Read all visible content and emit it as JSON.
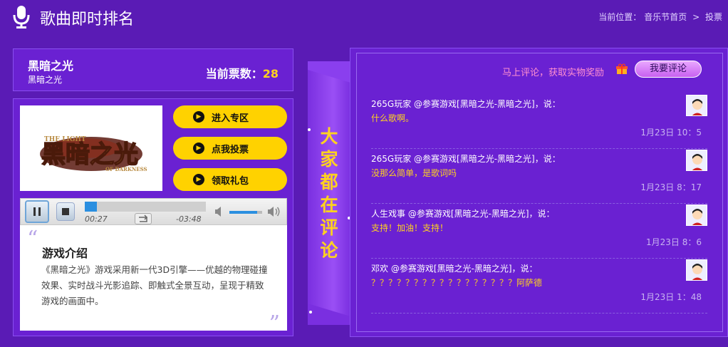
{
  "header": {
    "title": "歌曲即时排名",
    "breadcrumb": {
      "prefix": "当前位置：",
      "home": "音乐节首页",
      "separator": ">",
      "current": "投票"
    }
  },
  "song": {
    "name": "黑暗之光",
    "subtitle": "黑暗之光",
    "votes_label": "当前票数：",
    "votes": "28"
  },
  "game_logo": {
    "main": "黑暗之光",
    "small_top": "THE LIGHT",
    "small_bottom": "OF DARKNESS"
  },
  "actions": [
    {
      "label": "进入专区"
    },
    {
      "label": "点我投票"
    },
    {
      "label": "领取礼包"
    }
  ],
  "player": {
    "current_time": "00:27",
    "remaining_time": "-03:48",
    "progress": 0.1,
    "volume": 0.85
  },
  "intro": {
    "title": "游戏介绍",
    "text": "《黑暗之光》游戏采用新一代3D引擎——优越的物理碰撞效果、实时战斗光影追踪、即触式全景互动，呈现于精致游戏的画面中。"
  },
  "ribbon": {
    "text": "大家都在评论"
  },
  "comments_panel": {
    "promo": "马上评论，获取实物奖励",
    "comment_button": "我要评论",
    "items": [
      {
        "user": "265G玩家 @参赛游戏[黑暗之光-黑暗之光]，说：",
        "text": "什么歌啊。",
        "time": "1月23日 10：5"
      },
      {
        "user": "265G玩家 @参赛游戏[黑暗之光-黑暗之光]，说：",
        "text": "没那么简单，是歌词吗",
        "time": "1月23日 8：17"
      },
      {
        "user": "人生戏事 @参赛游戏[黑暗之光-黑暗之光]，说：",
        "text": "支持！加油！支持！",
        "time": "1月23日 8：6"
      },
      {
        "user": "邓欢 @参赛游戏[黑暗之光-黑暗之光]，说：",
        "text": "？？？？？？？？？？？？？？？？？阿萨德",
        "time": "1月23日 1：48"
      }
    ]
  },
  "colors": {
    "background": "#5a1bb5",
    "panel": "#6a21d2",
    "accent": "#ffd21f",
    "button": "#ffd200"
  }
}
